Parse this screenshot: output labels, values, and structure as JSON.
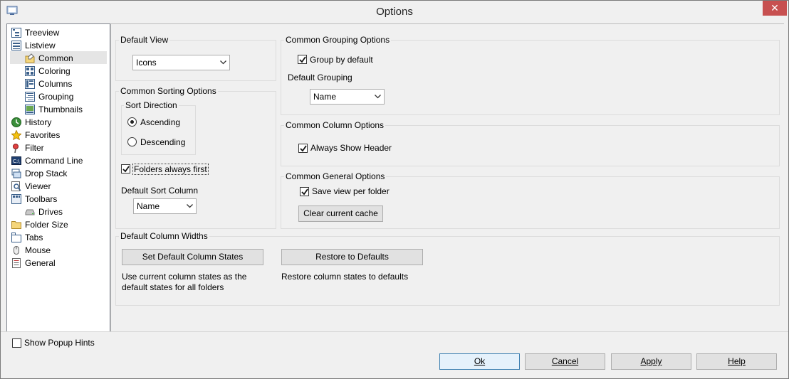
{
  "window": {
    "title": "Options",
    "close_glyph": "✕",
    "app_icon": "options-app-icon"
  },
  "tree": {
    "items": [
      {
        "label": "Treeview",
        "icon": "treeview-icon"
      },
      {
        "label": "Listview",
        "icon": "listview-icon"
      },
      {
        "label": "Common",
        "icon": "common-icon",
        "selected": true
      },
      {
        "label": "Coloring",
        "icon": "coloring-icon"
      },
      {
        "label": "Columns",
        "icon": "columns-icon"
      },
      {
        "label": "Grouping",
        "icon": "grouping-icon"
      },
      {
        "label": "Thumbnails",
        "icon": "thumbnails-icon"
      },
      {
        "label": "History",
        "icon": "history-icon"
      },
      {
        "label": "Favorites",
        "icon": "star-icon"
      },
      {
        "label": "Filter",
        "icon": "filter-icon"
      },
      {
        "label": "Command Line",
        "icon": "command-line-icon"
      },
      {
        "label": "Drop Stack",
        "icon": "drop-stack-icon"
      },
      {
        "label": "Viewer",
        "icon": "viewer-icon"
      },
      {
        "label": "Toolbars",
        "icon": "toolbars-icon"
      },
      {
        "label": "Drives",
        "icon": "drive-icon"
      },
      {
        "label": "Folder Size",
        "icon": "folder-icon"
      },
      {
        "label": "Tabs",
        "icon": "tabs-icon"
      },
      {
        "label": "Mouse",
        "icon": "mouse-icon"
      },
      {
        "label": "General",
        "icon": "general-icon"
      }
    ]
  },
  "default_view": {
    "title": "Default View",
    "value": "Icons"
  },
  "sorting": {
    "title": "Common Sorting Options",
    "direction_title": "Sort Direction",
    "ascending": "Ascending",
    "descending": "Descending",
    "selected": "Ascending",
    "folders_first_label": "Folders always first",
    "folders_first_checked": true,
    "sort_column_title": "Default Sort Column",
    "sort_column_value": "Name"
  },
  "grouping": {
    "title": "Common Grouping Options",
    "group_by_default_label": "Group by default",
    "group_by_default_checked": true,
    "default_grouping_title": "Default Grouping",
    "default_grouping_value": "Name"
  },
  "column_options": {
    "title": "Common Column Options",
    "always_show_header_label": "Always Show Header",
    "always_show_header_checked": true
  },
  "general_options": {
    "title": "Common General Options",
    "save_view_label": "Save view per folder",
    "save_view_checked": true,
    "clear_cache_label": "Clear current cache"
  },
  "column_widths": {
    "title": "Default Column Widths",
    "set_default_label": "Set Default Column States",
    "set_default_desc_1": "Use current column states as the",
    "set_default_desc_2": "default states for all folders",
    "restore_label": "Restore to Defaults",
    "restore_desc": "Restore column states to defaults"
  },
  "footer": {
    "show_popup_hints_label": "Show Popup Hints",
    "show_popup_hints_checked": false,
    "ok_label": "Ok",
    "cancel_label": "Cancel",
    "apply_label": "Apply",
    "help_label": "Help"
  }
}
